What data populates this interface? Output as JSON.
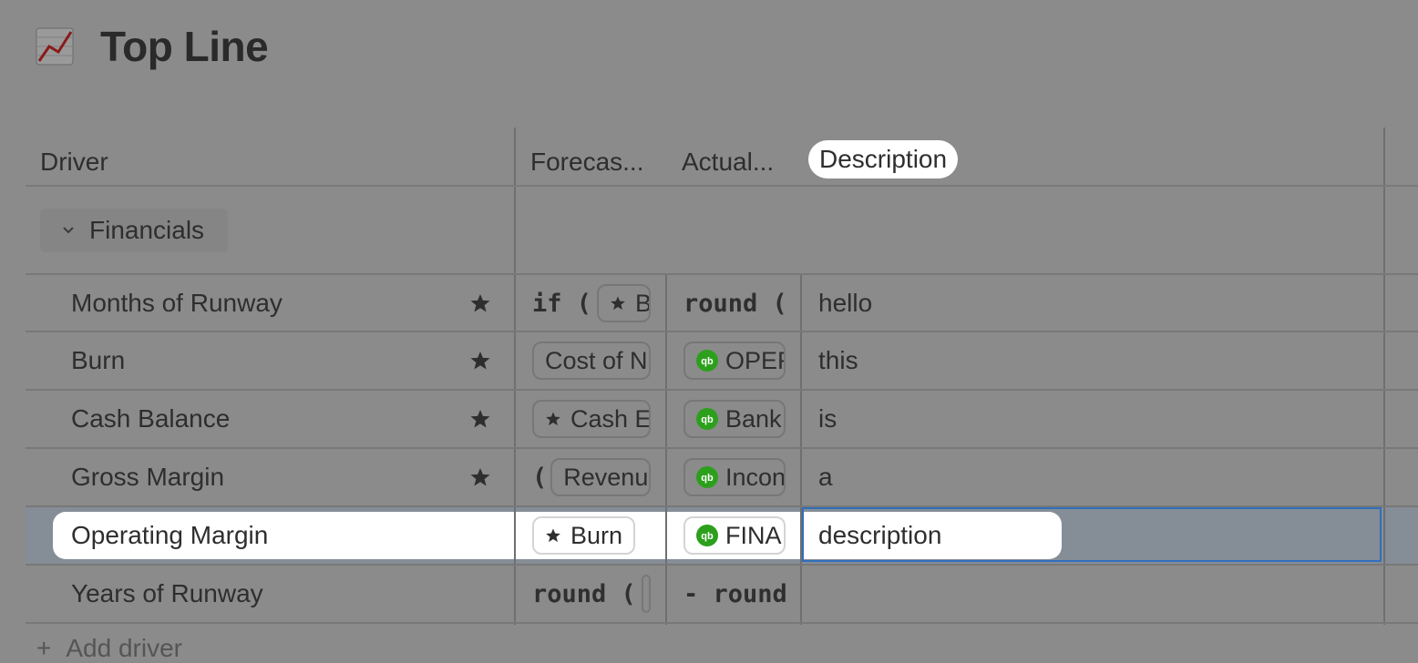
{
  "page": {
    "title": "Top Line",
    "title_icon": "chart-increasing-icon"
  },
  "columns": {
    "driver": "Driver",
    "forecast": "Forecas...",
    "actual": "Actual...",
    "description": "Description"
  },
  "group": {
    "label": "Financials"
  },
  "rows": [
    {
      "name": "Months of Runway",
      "starred": true,
      "forecast": {
        "prefix": "if (",
        "chip": "Bu",
        "chip_star": true
      },
      "actual": {
        "prefix": "round ("
      },
      "description": "hello"
    },
    {
      "name": "Burn",
      "starred": true,
      "forecast": {
        "chip": "Cost of N"
      },
      "actual": {
        "chip": "OPER",
        "qb": true
      },
      "description": "this"
    },
    {
      "name": "Cash Balance",
      "starred": true,
      "forecast": {
        "chip": "Cash E",
        "chip_star": true
      },
      "actual": {
        "chip": "Bank",
        "qb": true
      },
      "description": "is"
    },
    {
      "name": "Gross Margin",
      "starred": true,
      "forecast": {
        "prefix": "(",
        "chip": "Revenu"
      },
      "actual": {
        "chip": "Incon",
        "qb": true
      },
      "description": "a"
    },
    {
      "name": "Operating Margin",
      "starred": false,
      "selected": true,
      "forecast": {
        "chip": "Burn",
        "chip_star": true
      },
      "actual": {
        "chip": "FINAI",
        "qb": true
      },
      "description": "description"
    },
    {
      "name": "Years of Runway",
      "starred": false,
      "forecast": {
        "prefix": "round ("
      },
      "actual": {
        "prefix": "- round"
      },
      "description": ""
    }
  ],
  "add_driver_label": "Add driver",
  "colors": {
    "qb_green": "#2ca01c",
    "selection_border": "#2f6fba",
    "overlay": "#8b8b8b"
  }
}
